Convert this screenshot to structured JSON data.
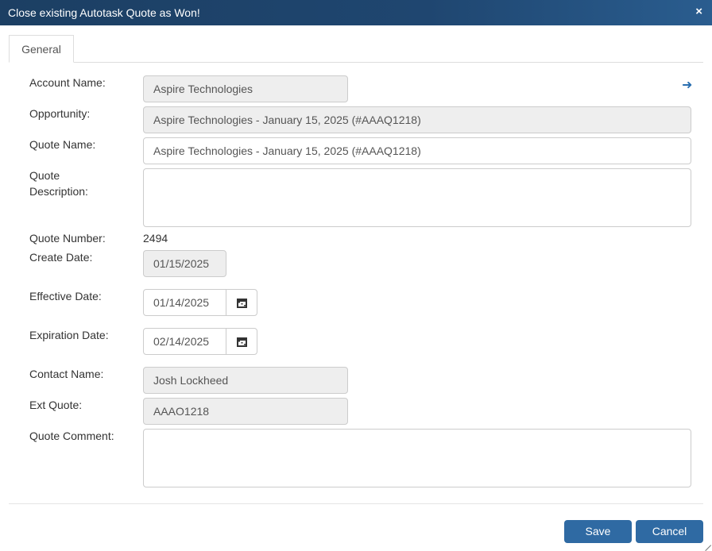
{
  "dialog": {
    "title": "Close existing Autotask Quote as Won!",
    "close_icon": "×"
  },
  "tabs": [
    {
      "label": "General"
    }
  ],
  "fields": {
    "account_name": {
      "label": "Account Name:",
      "value": "Aspire Technologies"
    },
    "opportunity": {
      "label": "Opportunity:",
      "value": "Aspire Technologies - January 15, 2025  (#AAAQ1218)"
    },
    "quote_name": {
      "label": "Quote Name:",
      "value": "Aspire Technologies - January 15, 2025  (#AAAQ1218)"
    },
    "quote_description": {
      "label_line1": "Quote",
      "label_line2": "Description:",
      "value": ""
    },
    "quote_number": {
      "label": "Quote Number:",
      "value": "2494"
    },
    "create_date": {
      "label": "Create Date:",
      "value": "01/15/2025"
    },
    "effective_date": {
      "label": "Effective Date:",
      "value": "01/14/2025"
    },
    "expiration_date": {
      "label": "Expiration Date:",
      "value": "02/14/2025"
    },
    "contact_name": {
      "label": "Contact Name:",
      "value": "Josh Lockheed"
    },
    "ext_quote": {
      "label": "Ext Quote:",
      "value": "AAAO1218"
    },
    "quote_comment": {
      "label": "Quote Comment:",
      "value": ""
    }
  },
  "icons": {
    "arrow": "➜"
  },
  "buttons": {
    "save": "Save",
    "cancel": "Cancel"
  }
}
